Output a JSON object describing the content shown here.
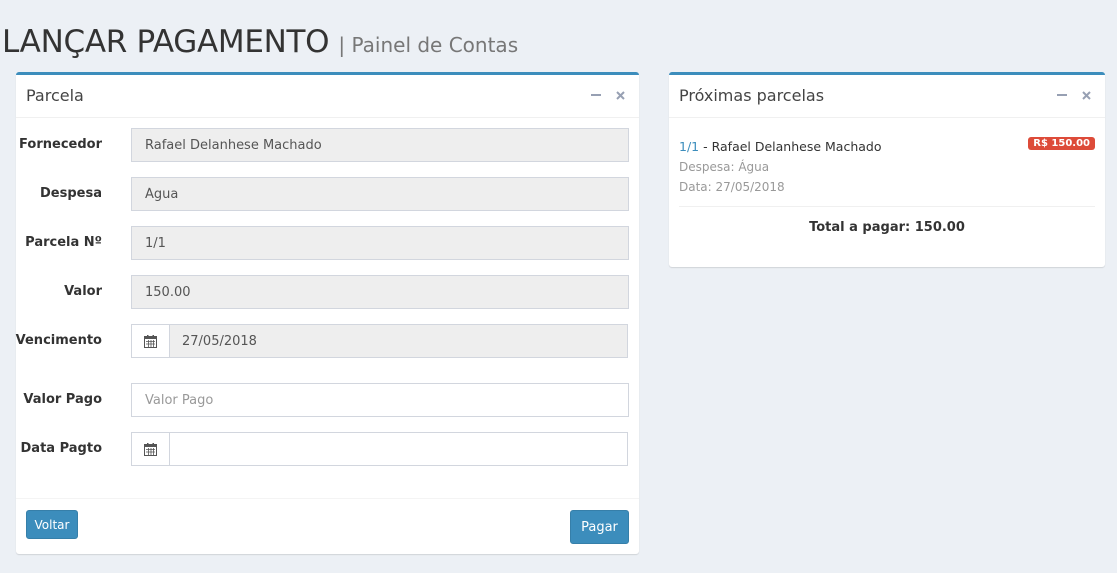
{
  "header": {
    "title": "LANÇAR PAGAMENTO",
    "subtitle": "| Painel de Contas"
  },
  "left_box": {
    "title": "Parcela",
    "fields": {
      "fornecedor": {
        "label": "Fornecedor",
        "value": "Rafael Delanhese Machado"
      },
      "despesa": {
        "label": "Despesa",
        "value": "Água"
      },
      "parcela": {
        "label": "Parcela Nº",
        "value": "1/1"
      },
      "valor": {
        "label": "Valor",
        "value": "150.00"
      },
      "vencimento": {
        "label": "Vencimento",
        "value": "27/05/2018"
      },
      "valor_pago": {
        "label": "Valor Pago",
        "value": "",
        "placeholder": "Valor Pago"
      },
      "data_pagto": {
        "label": "Data Pagto",
        "value": ""
      }
    },
    "buttons": {
      "back": "Voltar",
      "pay": "Pagar"
    }
  },
  "right_box": {
    "title": "Próximas parcelas",
    "items": [
      {
        "link": "1/1",
        "name": "- Rafael Delanhese Machado",
        "despesa": "Despesa: Água",
        "data": "Data: 27/05/2018",
        "badge": "R$ 150.00"
      }
    ],
    "total": "Total a pagar: 150.00"
  },
  "colors": {
    "accent": "#3c8dbc",
    "badge": "#dd4b39",
    "background": "#ecf0f5"
  },
  "icons": {
    "minimize": "minus-icon",
    "close": "times-icon",
    "calendar": "calendar-icon"
  }
}
